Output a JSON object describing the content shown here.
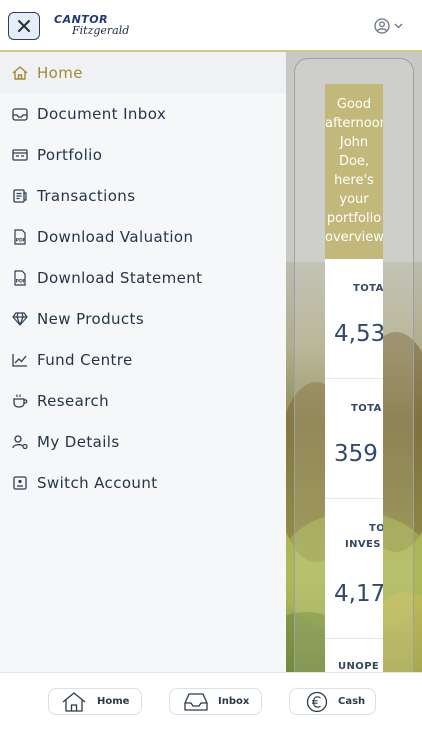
{
  "header": {
    "logo_line1": "CANTOR",
    "logo_line2": "Fitzgerald"
  },
  "nav": {
    "items": [
      {
        "label": "Home",
        "icon": "home-icon",
        "active": true
      },
      {
        "label": "Document Inbox",
        "icon": "inbox-icon"
      },
      {
        "label": "Portfolio",
        "icon": "portfolio-icon"
      },
      {
        "label": "Transactions",
        "icon": "transactions-icon"
      },
      {
        "label": "Download Valuation",
        "icon": "pdf-icon"
      },
      {
        "label": "Download Statement",
        "icon": "pdf-icon"
      },
      {
        "label": "New Products",
        "icon": "diamond-icon"
      },
      {
        "label": "Fund Centre",
        "icon": "chart-line-icon"
      },
      {
        "label": "Research",
        "icon": "coffee-cup-icon"
      },
      {
        "label": "My Details",
        "icon": "user-settings-icon"
      },
      {
        "label": "Switch Account",
        "icon": "switch-account-icon"
      }
    ]
  },
  "greeting": {
    "text": "Good afternoon John Doe, here's your portfolio overview"
  },
  "stats": [
    {
      "label": "TOTA",
      "value": "4,53"
    },
    {
      "label": "TOTA",
      "value": "359"
    },
    {
      "label": "TO",
      "label2": "INVES",
      "value": "4,17"
    },
    {
      "label": "UNOPE",
      "value": ""
    }
  ],
  "bottom_tabs": [
    {
      "label": "Home",
      "icon": "home-icon"
    },
    {
      "label": "Inbox",
      "icon": "inbox-icon"
    },
    {
      "label": "Cash",
      "icon": "euro-icon"
    }
  ],
  "colors": {
    "accent": "#a48a32",
    "navy": "#24354a",
    "card_gold": "#c2b87a"
  }
}
